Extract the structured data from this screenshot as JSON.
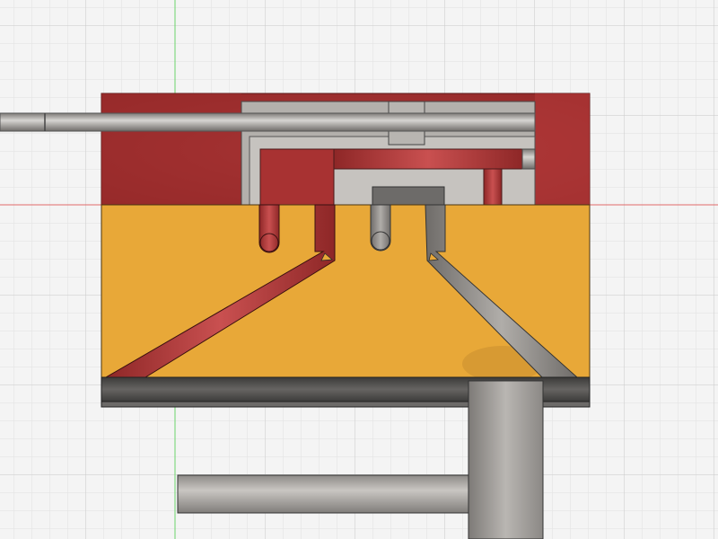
{
  "viewport": {
    "background": "#f4f4f4",
    "grid_minor_color": "#e1e1e1",
    "grid_major_color": "#c9c9c9",
    "x_axis_color": "#e06a6a",
    "y_axis_color": "#6ad46a"
  },
  "model": {
    "parts": [
      "red-block-body",
      "yellow-block-body",
      "base-plate",
      "gray-cylinder-housing",
      "piston-rod",
      "vertical-support-post",
      "horizontal-arm"
    ],
    "colors": {
      "red": "#a83232",
      "red_light": "#c14a4a",
      "yellow": "#e8a838",
      "gray": "#b3b0ac",
      "gray_dark": "#8a8785",
      "steel": "#9d9a97",
      "base_dark": "#4b4a48",
      "outline": "#2b2b2b"
    }
  }
}
